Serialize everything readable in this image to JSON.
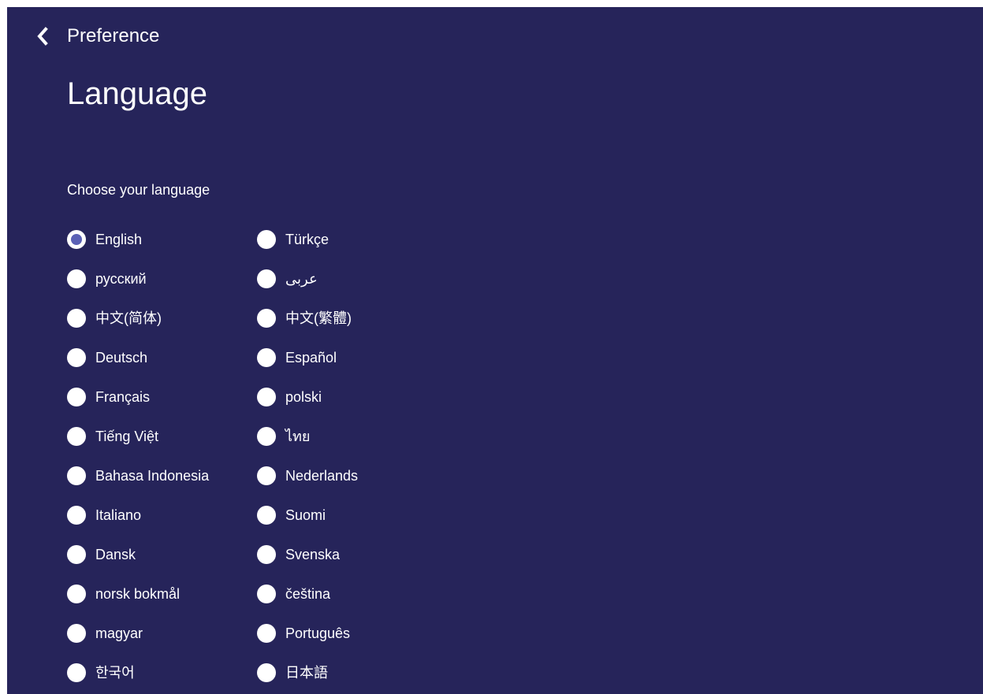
{
  "header": {
    "back_icon": "chevron-left-icon",
    "breadcrumb": "Preference"
  },
  "page": {
    "title": "Language",
    "subtitle": "Choose your language"
  },
  "colors": {
    "background": "#26245a",
    "radio_fill": "#ffffff",
    "radio_selected_dot": "#5b61b5",
    "text": "#ffffff"
  },
  "languages": {
    "selected": "English",
    "left": [
      {
        "label": "English",
        "selected": true
      },
      {
        "label": "русский",
        "selected": false
      },
      {
        "label": "中文(简体)",
        "selected": false
      },
      {
        "label": "Deutsch",
        "selected": false
      },
      {
        "label": "Français",
        "selected": false
      },
      {
        "label": "Tiếng Việt",
        "selected": false
      },
      {
        "label": "Bahasa Indonesia",
        "selected": false
      },
      {
        "label": "Italiano",
        "selected": false
      },
      {
        "label": "Dansk",
        "selected": false
      },
      {
        "label": "norsk bokmål",
        "selected": false
      },
      {
        "label": "magyar",
        "selected": false
      },
      {
        "label": "한국어",
        "selected": false
      }
    ],
    "right": [
      {
        "label": "Türkçe",
        "selected": false
      },
      {
        "label": "عربى",
        "selected": false
      },
      {
        "label": "中文(繁體)",
        "selected": false
      },
      {
        "label": "Español",
        "selected": false
      },
      {
        "label": "polski",
        "selected": false
      },
      {
        "label": "ไทย",
        "selected": false
      },
      {
        "label": "Nederlands",
        "selected": false
      },
      {
        "label": "Suomi",
        "selected": false
      },
      {
        "label": "Svenska",
        "selected": false
      },
      {
        "label": "čeština",
        "selected": false
      },
      {
        "label": "Português",
        "selected": false
      },
      {
        "label": "日本語",
        "selected": false
      }
    ]
  }
}
